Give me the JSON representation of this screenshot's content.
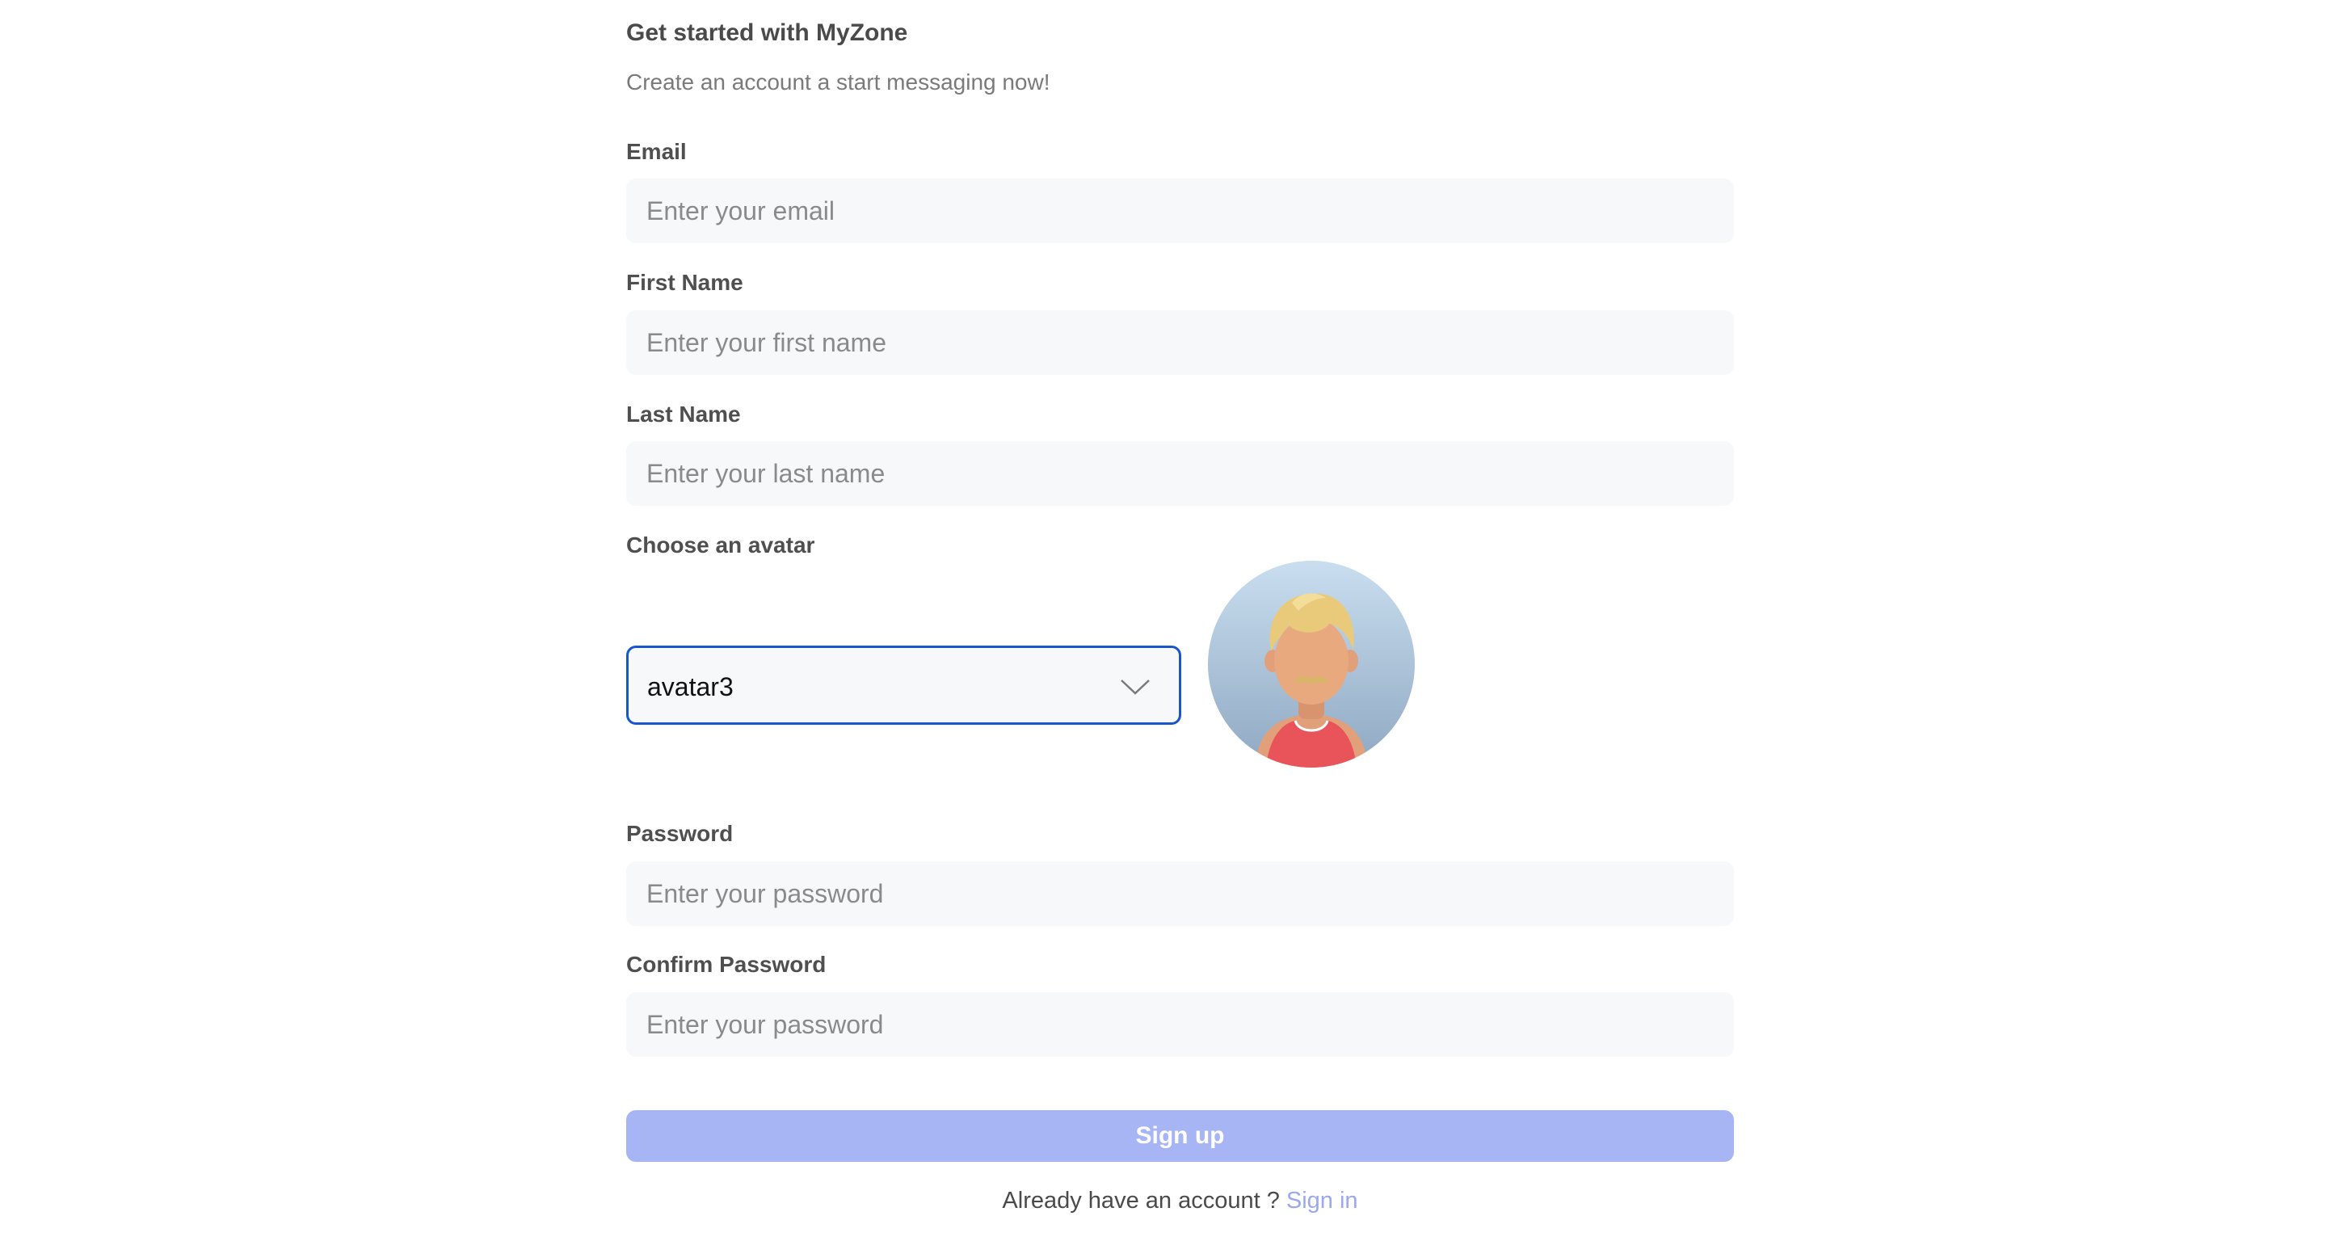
{
  "header": {
    "title": "Get started with MyZone",
    "subtitle": "Create an account a start messaging now!"
  },
  "fields": {
    "email": {
      "label": "Email",
      "placeholder": "Enter your email",
      "value": ""
    },
    "first_name": {
      "label": "First Name",
      "placeholder": "Enter your first name",
      "value": ""
    },
    "last_name": {
      "label": "Last Name",
      "placeholder": "Enter your last name",
      "value": ""
    },
    "avatar": {
      "label": "Choose an avatar",
      "selected": "avatar3"
    },
    "password": {
      "label": "Password",
      "placeholder": "Enter your password",
      "value": ""
    },
    "confirm_password": {
      "label": "Confirm Password",
      "placeholder": "Enter your password",
      "value": ""
    }
  },
  "actions": {
    "signup_label": "Sign up"
  },
  "footer": {
    "prompt": "Already have an account ?",
    "link": "Sign in"
  },
  "colors": {
    "accent": "#a7b5f5",
    "focus_border": "#1a56c9",
    "link": "#9aa8f2",
    "input_bg": "#f7f8fa"
  },
  "icons": {
    "select_chevron": "chevron-down-icon",
    "avatar_image": "avatar-illustration"
  }
}
